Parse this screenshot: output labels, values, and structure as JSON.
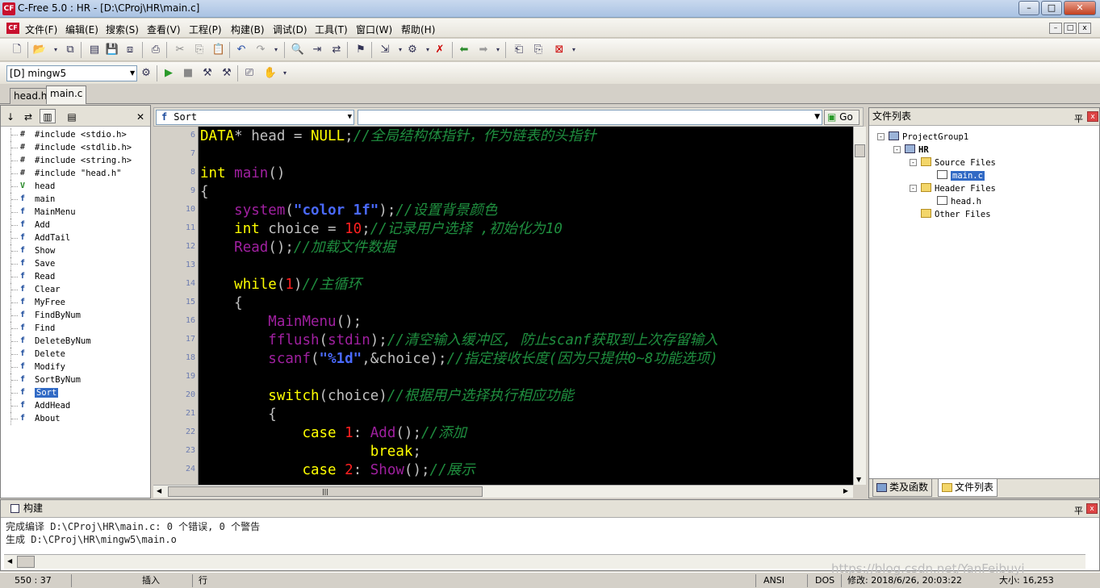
{
  "window": {
    "title": "C-Free 5.0 : HR - [D:\\CProj\\HR\\main.c]",
    "app_icon": "CF",
    "minimize": "–",
    "maximize": "□",
    "close": "✕"
  },
  "menu": [
    "文件(F)",
    "编辑(E)",
    "搜索(S)",
    "查看(V)",
    "工程(P)",
    "构建(B)",
    "调试(D)",
    "工具(T)",
    "窗口(W)",
    "帮助(H)"
  ],
  "compiler": {
    "selected": "[D] mingw5"
  },
  "file_tabs": [
    "head.h",
    "main.c"
  ],
  "symbols": [
    {
      "icon": "#",
      "kind": "inc",
      "label": "#include <stdio.h>"
    },
    {
      "icon": "#",
      "kind": "inc",
      "label": "#include <stdlib.h>"
    },
    {
      "icon": "#",
      "kind": "inc",
      "label": "#include <string.h>"
    },
    {
      "icon": "#",
      "kind": "inc",
      "label": "#include \"head.h\""
    },
    {
      "icon": "V",
      "kind": "var",
      "label": "head"
    },
    {
      "icon": "f",
      "kind": "fn",
      "label": "main"
    },
    {
      "icon": "f",
      "kind": "fn",
      "label": "MainMenu"
    },
    {
      "icon": "f",
      "kind": "fn",
      "label": "Add"
    },
    {
      "icon": "f",
      "kind": "fn",
      "label": "AddTail"
    },
    {
      "icon": "f",
      "kind": "fn",
      "label": "Show"
    },
    {
      "icon": "f",
      "kind": "fn",
      "label": "Save"
    },
    {
      "icon": "f",
      "kind": "fn",
      "label": "Read"
    },
    {
      "icon": "f",
      "kind": "fn",
      "label": "Clear"
    },
    {
      "icon": "f",
      "kind": "fn",
      "label": "MyFree"
    },
    {
      "icon": "f",
      "kind": "fn",
      "label": "FindByNum"
    },
    {
      "icon": "f",
      "kind": "fn",
      "label": "Find"
    },
    {
      "icon": "f",
      "kind": "fn",
      "label": "DeleteByNum"
    },
    {
      "icon": "f",
      "kind": "fn",
      "label": "Delete"
    },
    {
      "icon": "f",
      "kind": "fn",
      "label": "Modify"
    },
    {
      "icon": "f",
      "kind": "fn",
      "label": "SortByNum"
    },
    {
      "icon": "f",
      "kind": "fn",
      "label": "Sort",
      "selected": true
    },
    {
      "icon": "f",
      "kind": "fn",
      "label": "AddHead"
    },
    {
      "icon": "f",
      "kind": "fn",
      "label": "About"
    }
  ],
  "editor": {
    "function_selector": "Sort",
    "go_label": "Go",
    "line_numbers": [
      "6",
      "7",
      "8",
      "9",
      "10",
      "11",
      "12",
      "13",
      "14",
      "15",
      "16",
      "17",
      "18",
      "19",
      "20",
      "21",
      "22",
      "23",
      "24"
    ],
    "lines": [
      [
        [
          "k",
          "DATA"
        ],
        [
          "p",
          "* head = "
        ],
        [
          "k",
          "NULL"
        ],
        [
          "p",
          ";"
        ],
        [
          "c",
          "//全局结构体指针，作为链表的头指针"
        ]
      ],
      [],
      [
        [
          "k",
          "int"
        ],
        [
          "p",
          " "
        ],
        [
          "f",
          "main"
        ],
        [
          "p",
          "()"
        ]
      ],
      [
        [
          "p",
          "{"
        ]
      ],
      [
        [
          "p",
          "    "
        ],
        [
          "f",
          "system"
        ],
        [
          "p",
          "("
        ],
        [
          "s",
          "\"color 1f\""
        ],
        [
          "p",
          ");"
        ],
        [
          "c",
          "//设置背景颜色"
        ]
      ],
      [
        [
          "p",
          "    "
        ],
        [
          "k",
          "int"
        ],
        [
          "p",
          " choice = "
        ],
        [
          "n",
          "10"
        ],
        [
          "p",
          ";"
        ],
        [
          "c",
          "//记录用户选择 ,初始化为10"
        ]
      ],
      [
        [
          "p",
          "    "
        ],
        [
          "f",
          "Read"
        ],
        [
          "p",
          "();"
        ],
        [
          "c",
          "//加载文件数据"
        ]
      ],
      [],
      [
        [
          "p",
          "    "
        ],
        [
          "k",
          "while"
        ],
        [
          "p",
          "("
        ],
        [
          "n",
          "1"
        ],
        [
          "p",
          ")"
        ],
        [
          "c",
          "//主循环"
        ]
      ],
      [
        [
          "p",
          "    {"
        ]
      ],
      [
        [
          "p",
          "        "
        ],
        [
          "f",
          "MainMenu"
        ],
        [
          "p",
          "();"
        ]
      ],
      [
        [
          "p",
          "        "
        ],
        [
          "f",
          "fflush"
        ],
        [
          "p",
          "("
        ],
        [
          "f",
          "stdin"
        ],
        [
          "p",
          ");"
        ],
        [
          "c",
          "//清空输入缓冲区, 防止scanf获取到上次存留输入"
        ]
      ],
      [
        [
          "p",
          "        "
        ],
        [
          "f",
          "scanf"
        ],
        [
          "p",
          "("
        ],
        [
          "s",
          "\"%1d\""
        ],
        [
          "p",
          ",&choice);"
        ],
        [
          "c",
          "//指定接收长度(因为只提供0~8功能选项)"
        ]
      ],
      [],
      [
        [
          "p",
          "        "
        ],
        [
          "k",
          "switch"
        ],
        [
          "p",
          "(choice)"
        ],
        [
          "c",
          "//根据用户选择执行相应功能"
        ]
      ],
      [
        [
          "p",
          "        {"
        ]
      ],
      [
        [
          "p",
          "            "
        ],
        [
          "k",
          "case"
        ],
        [
          "p",
          " "
        ],
        [
          "n",
          "1"
        ],
        [
          "p",
          ": "
        ],
        [
          "f",
          "Add"
        ],
        [
          "p",
          "();"
        ],
        [
          "c",
          "//添加"
        ]
      ],
      [
        [
          "p",
          "                    "
        ],
        [
          "k",
          "break"
        ],
        [
          "p",
          ";"
        ]
      ],
      [
        [
          "p",
          "            "
        ],
        [
          "k",
          "case"
        ],
        [
          "p",
          " "
        ],
        [
          "n",
          "2"
        ],
        [
          "p",
          ": "
        ],
        [
          "f",
          "Show"
        ],
        [
          "p",
          "();"
        ],
        [
          "c",
          "//展示"
        ]
      ]
    ]
  },
  "file_list": {
    "title": "文件列表",
    "pin": "平",
    "close": "x",
    "nodes": [
      {
        "label": "ProjectGroup1",
        "type": "proj",
        "level": 0,
        "expander": "-"
      },
      {
        "label": "HR",
        "type": "proj",
        "level": 1,
        "expander": "-"
      },
      {
        "label": "Source Files",
        "type": "folder",
        "level": 2,
        "expander": "-"
      },
      {
        "label": "main.c",
        "type": "file",
        "level": 3,
        "selected": true
      },
      {
        "label": "Header Files",
        "type": "folder",
        "level": 2,
        "expander": "-"
      },
      {
        "label": "head.h",
        "type": "file",
        "level": 3
      },
      {
        "label": "Other Files",
        "type": "folder",
        "level": 2
      }
    ],
    "tabs": [
      "类及函数",
      "文件列表"
    ]
  },
  "build": {
    "title": "构建",
    "lines": [
      "完成编译 D:\\CProj\\HR\\main.c: 0 个错误, 0 个警告",
      "生成 D:\\CProj\\HR\\mingw5\\main.o"
    ]
  },
  "status": {
    "position": "550 : 37",
    "mode": "插入",
    "line_label": "行",
    "encoding": "ANSI",
    "eol": "DOS",
    "modified": "修改: 2018/6/26, 20:03:22",
    "size": "大小: 16,253"
  },
  "watermark": "https://blog.csdn.net/YanFeibuyi"
}
